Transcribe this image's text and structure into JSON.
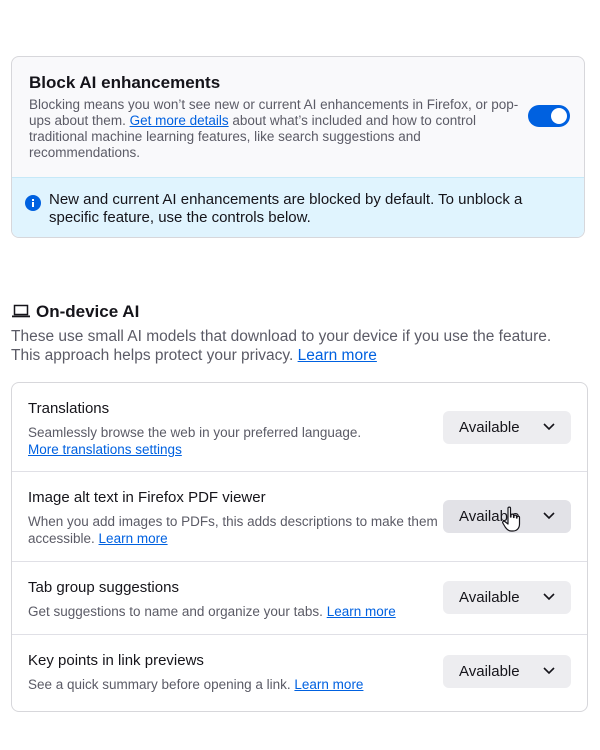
{
  "block_ai": {
    "title": "Block AI enhancements",
    "desc_before": "Blocking means you won’t see new or current AI enhancements in Firefox, or pop-ups about them. ",
    "link": "Get more details",
    "desc_after": " about what’s included and how to control traditional machine learning features, like search suggestions and recommendations.",
    "toggle_on": true,
    "info": "New and current AI enhancements are blocked by default. To unblock a specific feature, use the controls below."
  },
  "on_device": {
    "title": "On-device AI",
    "desc": "These use small AI models that download to your device if you use the feature. This approach helps protect your privacy. ",
    "learn_more": "Learn more"
  },
  "features": [
    {
      "label": "Translations",
      "desc": "Seamlessly browse the web in your preferred language.",
      "link": "More translations settings",
      "status": "Available"
    },
    {
      "label": "Image alt text in Firefox PDF viewer",
      "desc": "When you add images to PDFs, this adds descriptions to make them accessible. ",
      "link": "Learn more",
      "status": "Available"
    },
    {
      "label": "Tab group suggestions",
      "desc": "Get suggestions to name and organize your tabs. ",
      "link": "Learn more",
      "status": "Available"
    },
    {
      "label": "Key points in link previews",
      "desc": "See a quick summary before opening a link. ",
      "link": "Learn more",
      "status": "Available"
    }
  ],
  "colors": {
    "accent": "#0061e0",
    "info_bg": "#e0f4fe",
    "card_bg": "#f9f9fb",
    "dropdown_bg": "#ededf0"
  }
}
